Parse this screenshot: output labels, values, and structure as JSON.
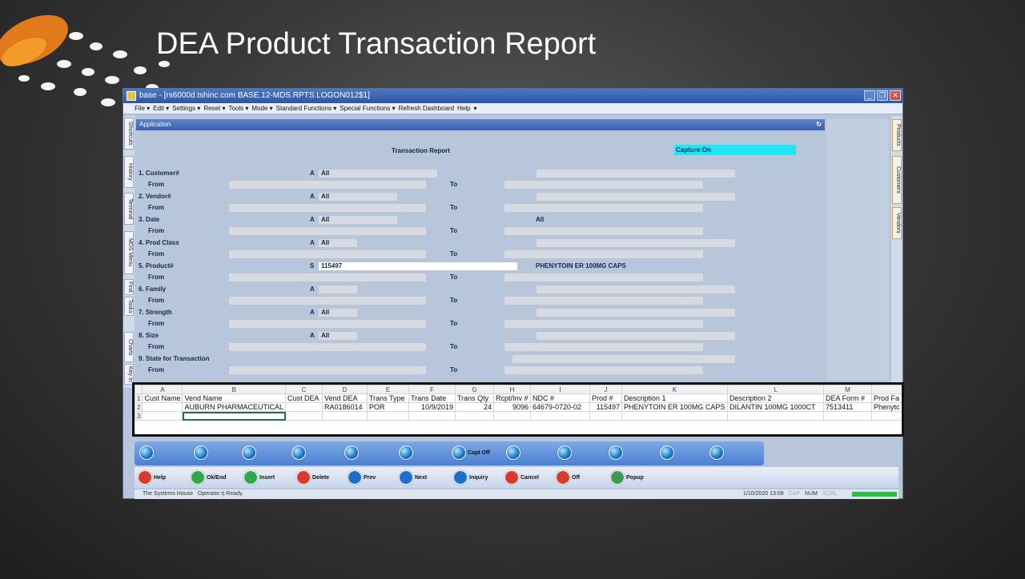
{
  "slide": {
    "title": "DEA Product Transaction Report"
  },
  "window": {
    "title": "base - [rs6000d.tshinc.com BASE.12-MDS.RPTS.LOGON012$1]",
    "menu": [
      "File ▾",
      "Edit ▾",
      "Settings ▾",
      "Reset ▾",
      "Tools ▾",
      "Mode ▾",
      "Standard Functions ▾",
      "Special Functions ▾",
      "Refresh Dashboard",
      "Help",
      "▾"
    ],
    "left_tabs": [
      "Shortcuts",
      "History",
      "Terminal",
      "MDS Menu",
      "Find",
      "Tasks",
      "Charts",
      "Key In"
    ],
    "right_tabs": [
      "Products",
      "Customers",
      "Vendors"
    ]
  },
  "app": {
    "header": "Application",
    "report_title": "Transaction Report",
    "capture": "Capture:On",
    "from_label": "From",
    "to_label": "To",
    "fields": [
      {
        "label": "1. Customer#",
        "sel": "A",
        "value": "All",
        "desc": ""
      },
      {
        "label": "2. Vendor#",
        "sel": "A",
        "value": "All",
        "desc": ""
      },
      {
        "label": "3. Date",
        "sel": "A",
        "value": "All",
        "desc": "All"
      },
      {
        "label": "4. Prod Class",
        "sel": "A",
        "value": "All",
        "desc": ""
      },
      {
        "label": "5. Product#",
        "sel": "S",
        "value": "115497",
        "desc": "PHENYTOIN ER 100MG CAPS"
      },
      {
        "label": "6. Family",
        "sel": "A",
        "value": "",
        "desc": ""
      },
      {
        "label": "7. Strength",
        "sel": "A",
        "value": "All",
        "desc": ""
      },
      {
        "label": "8. Size",
        "sel": "A",
        "value": "All",
        "desc": ""
      },
      {
        "label": "9. State for Transaction",
        "sel": "",
        "value": "",
        "desc": ""
      }
    ]
  },
  "grid": {
    "columns": [
      "A",
      "B",
      "C",
      "D",
      "E",
      "F",
      "G",
      "H",
      "I",
      "J",
      "K",
      "L",
      "M",
      ""
    ],
    "rows": [
      [
        "Cust Name",
        "Vend Name",
        "Cust DEA",
        "Vend DEA",
        "Trans Type",
        "Trans Date",
        "Trans Qty",
        "Rcpt/Inv #",
        "NDC #",
        "Prod #",
        "Description 1",
        "Description 2",
        "DEA Form #",
        "Prod Fa"
      ],
      [
        "",
        "AUBURN PHARMACEUTICAL",
        "",
        "RA0186014",
        "POR",
        "10/9/2019",
        "24",
        "9096",
        "64679-0720-02",
        "115497",
        "PHENYTOIN ER 100MG CAPS",
        "DILANTIN 100MG 1000CT",
        "7513411",
        "Phenytc"
      ],
      [
        "",
        "",
        "",
        "",
        "",
        "",
        "",
        "",
        "",
        "",
        "",
        "",
        "",
        ""
      ]
    ]
  },
  "toolbar": {
    "capt_label": "Capt Off",
    "buttons": [
      {
        "label": "Help",
        "color": "#d93a2b"
      },
      {
        "label": "Ok/End",
        "color": "#2fa84a"
      },
      {
        "label": "Insert",
        "color": "#2fa84a"
      },
      {
        "label": "Delete",
        "color": "#d93a2b"
      },
      {
        "label": "Prev",
        "color": "#1d6fcf"
      },
      {
        "label": "Next",
        "color": "#1d6fcf"
      },
      {
        "label": "Inquiry",
        "color": "#1d6fcf"
      },
      {
        "label": "Cancel",
        "color": "#d93a2b"
      },
      {
        "label": "Off",
        "color": "#d93a2b"
      },
      {
        "label": "Popup",
        "color": "#3c9a55"
      }
    ]
  },
  "status": {
    "app_name": "The Systems House",
    "message": "Operator:rj Ready.",
    "datetime": "1/10/2020 13:08",
    "indicators": [
      "CAP",
      "NUM",
      "SCRL"
    ]
  }
}
